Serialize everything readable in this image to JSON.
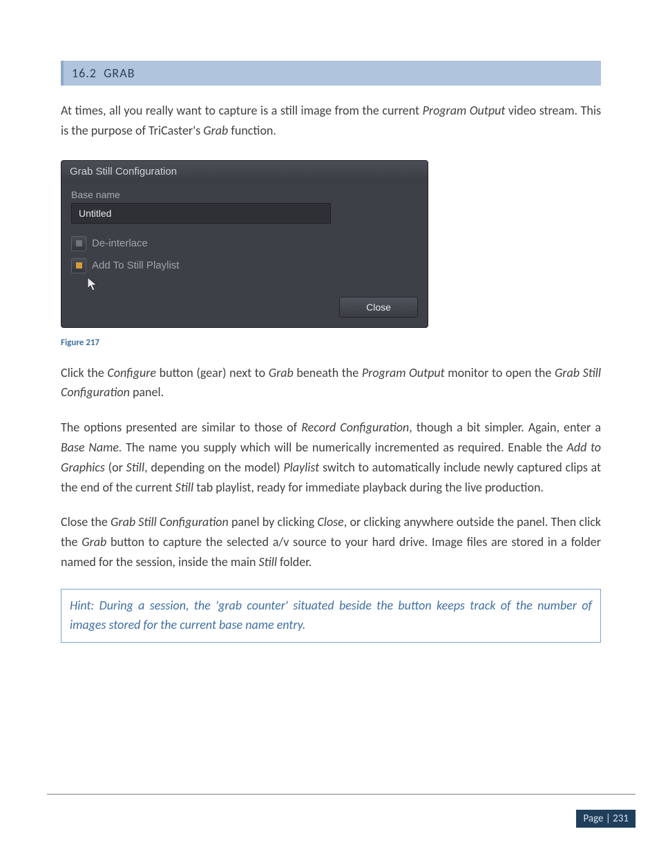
{
  "section": {
    "number": "16.2",
    "title": "GRAB"
  },
  "para1": {
    "lead": "At times, all you really want to capture is a still image from the current ",
    "ital1": "Program Output",
    "mid": " video stream.  This is the purpose of TriCaster's ",
    "ital2": "Grab",
    "tail": " function."
  },
  "dlg": {
    "title": "Grab Still Configuration",
    "base_name_label": "Base name",
    "base_name_value": "Untitled",
    "check1_label": "De-interlace",
    "check2_label": "Add To Still Playlist",
    "close_label": "Close"
  },
  "figure_label": "Figure 217",
  "para2": {
    "t0": "Click the ",
    "i0": "Configure",
    "t1": " button (gear) next to ",
    "i1": "Grab",
    "t2": " beneath the ",
    "i2": "Program Output",
    "t3": " monitor to open the ",
    "i3": "Grab Still Configuration",
    "t4": " panel."
  },
  "para3": {
    "t0": "The options presented are similar to those of ",
    "i0": "Record Configuration",
    "t1": ", though a bit simpler.  Again, enter a ",
    "i1": "Base Name.",
    "t2": " The name you supply which will be numerically incremented as required. Enable the ",
    "i2": "Add to Graphics",
    "t3": " (or ",
    "i3": "Still",
    "t4": ", depending on the model) ",
    "i4": "Playlist",
    "t5": " switch to automatically include newly captured clips at the end of the current ",
    "i5": "Still",
    "t6": " tab playlist, ready for immediate playback during the live production."
  },
  "para4": {
    "t0": "Close the ",
    "i0": "Grab Still Configuration",
    "t1": " panel by clicking ",
    "i1": "Close",
    "t2": ", or clicking anywhere outside the panel. Then click the ",
    "i2": "Grab",
    "t3": " button to capture the selected a/v source to your hard drive.  Image files are stored in a folder named for the session, inside the main ",
    "i3": "Still",
    "t4": " folder."
  },
  "hint": "Hint: During a session, the 'grab counter' situated beside the button keeps track of the number of images stored for the current base name entry.",
  "footer": {
    "page_label": "Page | 231"
  }
}
